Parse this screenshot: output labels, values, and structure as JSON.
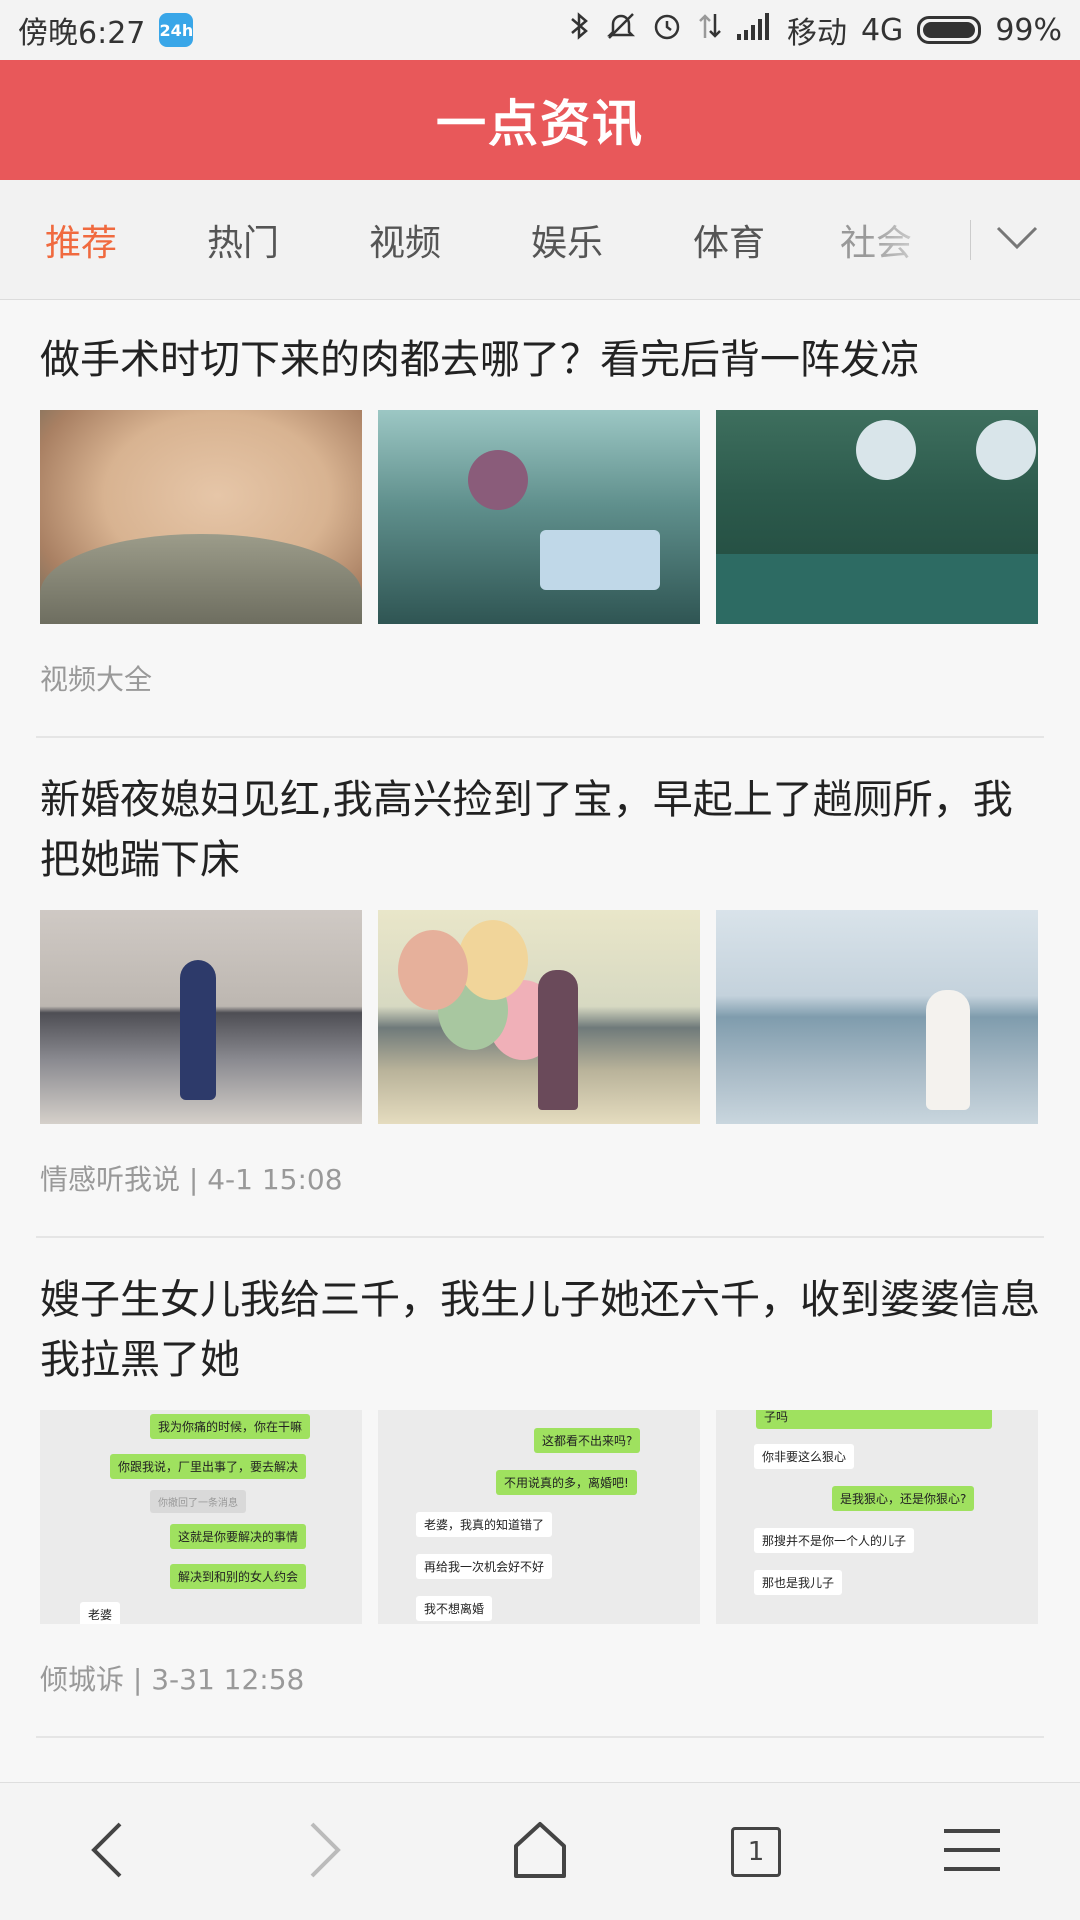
{
  "status_bar": {
    "time": "傍晚6:27",
    "badge": "24h",
    "carrier": "移动",
    "network": "4G",
    "battery": "99%",
    "icons": [
      "bluetooth-icon",
      "mute-icon",
      "alarm-icon",
      "data-transfer-icon",
      "signal-icon",
      "battery-icon"
    ]
  },
  "header": {
    "title": "一点资讯"
  },
  "tabs": {
    "items": [
      "推荐",
      "热门",
      "视频",
      "娱乐",
      "体育",
      "社会"
    ],
    "active_index": 0,
    "active_color": "#f06a3f"
  },
  "articles": [
    {
      "title": "做手术时切下来的肉都去哪了？看完后背一阵发凉",
      "meta": "视频大全",
      "thumbnails": [
        "neck-photo",
        "surgery-photo",
        "operating-room-photo"
      ]
    },
    {
      "title": "新婚夜媳妇见红,我高兴捡到了宝，早起上了趟厕所，我把她踹下床",
      "meta": "情感听我说 | 4-1 15:08",
      "thumbnails": [
        "beach-woman-photo",
        "beach-balloons-photo",
        "sea-woman-photo"
      ]
    },
    {
      "title": "嫂子生女儿我给三千，我生儿子她还六千，收到婆婆信息我拉黑了她",
      "meta": "倾城诉 | 3-31 12:58",
      "thumbnails": [
        "chat-screenshot-1",
        "chat-screenshot-2",
        "chat-screenshot-3"
      ],
      "chat1": [
        "我为你痛的时候，你在干嘛",
        "你跟我说，厂里出事了，要去解决",
        "你撤回了一条消息",
        "这就是你要解决的事情",
        "解决到和别的女人约会",
        "老婆"
      ],
      "chat2": [
        "这都看不出来吗?",
        "不用说真的多，离婚吧!",
        "老婆，我真的知道错了",
        "再给我一次机会好不好",
        "我不想离婚"
      ],
      "chat3": [
        "子吗",
        "你非要这么狠心",
        "是我狠心，还是你狠心?",
        "那搜并不是你一个人的儿子",
        "那也是我儿子"
      ]
    }
  ],
  "bottom_nav": {
    "tab_count": "1",
    "icons": [
      "back-icon",
      "forward-icon",
      "home-icon",
      "tabs-icon",
      "menu-icon"
    ]
  },
  "colors": {
    "brand_red": "#e8585a",
    "accent_orange": "#f06a3f"
  }
}
